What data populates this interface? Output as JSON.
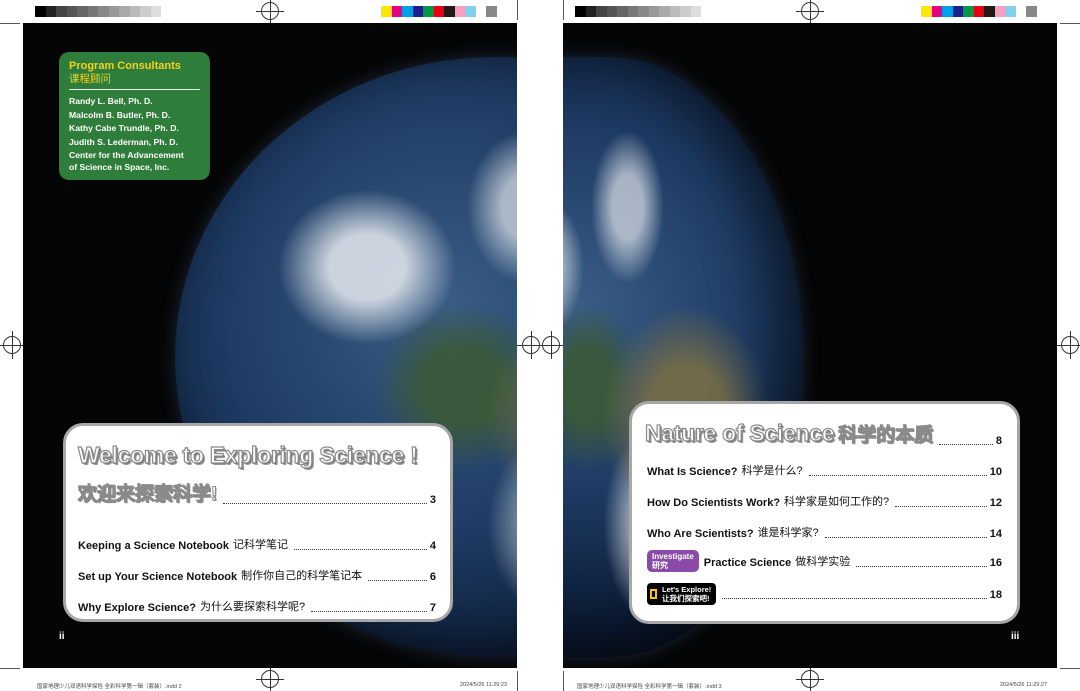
{
  "colors": {
    "consultant_box": "#2f7d3a",
    "consultant_title": "#f4d21a",
    "card_border": "#a7a7a7",
    "investigate_tag": "#8a4aa8",
    "explore_tag": "#000000"
  },
  "left_page": {
    "consultants": {
      "title_en": "Program Consultants",
      "title_cn": "课程顾问",
      "names": [
        "Randy L. Bell, Ph. D.",
        "Malcolm B. Butler, Ph. D.",
        "Kathy Cabe Trundle, Ph. D.",
        "Judith S. Lederman, Ph. D."
      ],
      "org_line1": "Center for the Advancement",
      "org_line2": "of Science in Space, Inc."
    },
    "toc": {
      "title_en": "Welcome to Exploring Science !",
      "title_cn": "欢迎来探索科学!",
      "title_page": "3",
      "items": [
        {
          "label": "Keeping a Science Notebook",
          "cn": "记科学笔记",
          "page": "4"
        },
        {
          "label": "Set up Your Science Notebook",
          "cn": "制作你自己的科学笔记本",
          "page": "6"
        },
        {
          "label": "Why Explore Science?",
          "cn": "为什么要探索科学呢?",
          "page": "7"
        }
      ]
    },
    "folio": "ii",
    "slug_left": "国家地理少儿双语科学探险 全彩科学第一辑（套装）.indd 2",
    "slug_right": "2024/5/26 11:29:23"
  },
  "right_page": {
    "toc": {
      "title_en": "Nature of Science",
      "title_cn": "科学的本质",
      "title_page": "8",
      "items": [
        {
          "label": "What Is Science?",
          "cn": "科学是什么?",
          "page": "10"
        },
        {
          "label": "How Do Scientists Work?",
          "cn": "科学家是如何工作的?",
          "page": "12"
        },
        {
          "label": "Who Are Scientists?",
          "cn": "谁是科学家?",
          "page": "14"
        },
        {
          "tag_en": "Investigate",
          "tag_cn": "研究",
          "label": "Practice Science",
          "cn": "做科学实验",
          "page": "16"
        },
        {
          "tag_en": "Let's Explore!",
          "tag_cn": "让我们探索吧!",
          "label": "",
          "cn": "",
          "page": "18"
        }
      ]
    },
    "folio": "iii",
    "slug_left": "国家地理少儿双语科学探险 全彩科学第一辑（套装）.indd 3",
    "slug_right": "2024/5/26 11:29:27"
  }
}
